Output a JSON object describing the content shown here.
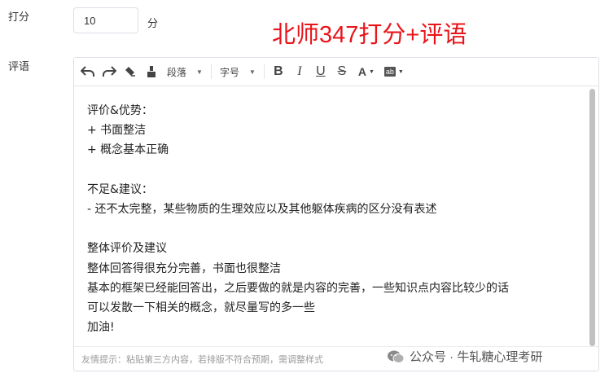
{
  "form": {
    "score_label": "打分",
    "score_value": "10",
    "score_unit": "分",
    "comment_label": "评语"
  },
  "overlay_title": "北师347打分+评语",
  "toolbar": {
    "paragraph_label": "段落",
    "fontsize_label": "字号",
    "bold": "B",
    "italic": "I",
    "underline": "U",
    "strike": "S",
    "font_color": "A",
    "bg_color": "ab"
  },
  "editor": {
    "lines": [
      "评价&优势：",
      "+ 书面整洁",
      "+ 概念基本正确",
      "",
      "不足&建议：",
      "- 还不太完整，某些物质的生理效应以及其他躯体疾病的区分没有表述",
      "",
      "整体评价及建议",
      "整体回答得很充分完善，书面也很整洁",
      "基本的框架已经能回答出，之后要做的就是内容的完善，一些知识点内容比较少的话",
      "可以发散一下相关的概念，就尽量写的多一些",
      "加油!"
    ],
    "footer_hint": "友情提示：粘贴第三方内容，若排版不符合预期，需调整样式"
  },
  "watermark": "公众号 · 牛轧糖心理考研",
  "colors": {
    "title_red": "#e8151b",
    "border": "#dcdfe6"
  }
}
